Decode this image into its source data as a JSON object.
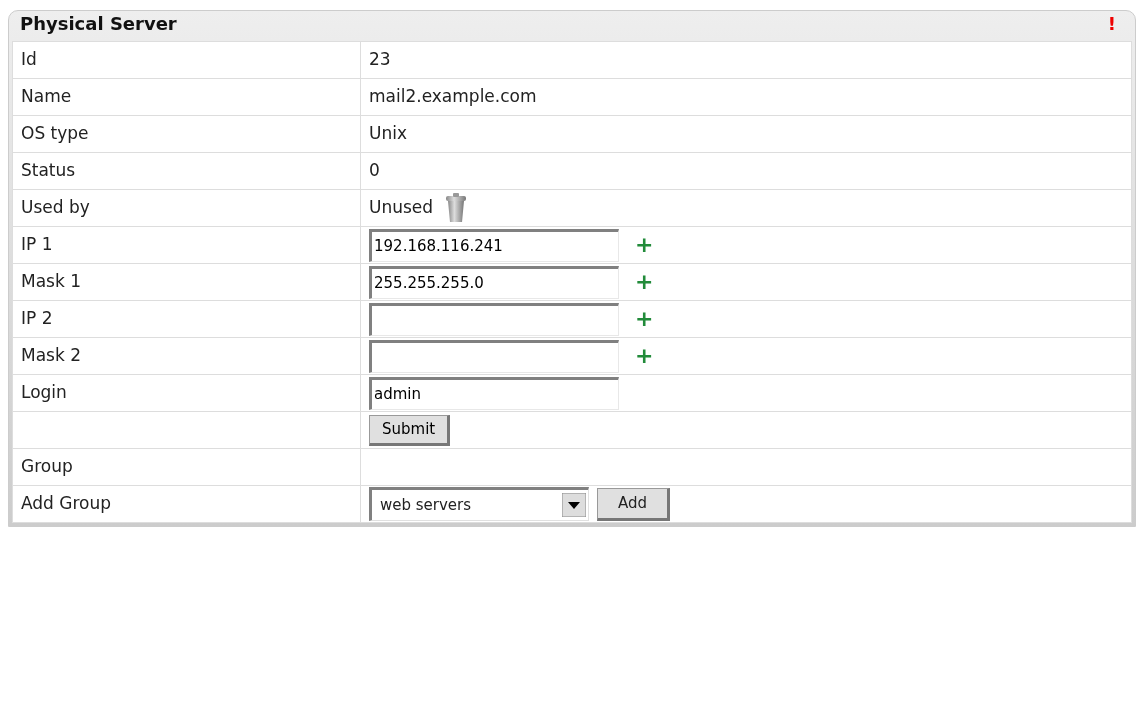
{
  "panel": {
    "title": "Physical Server",
    "alert": "!"
  },
  "rows": [
    {
      "kind": "text",
      "label": "Id",
      "value": "23"
    },
    {
      "kind": "text",
      "label": "Name",
      "value": "mail2.example.com"
    },
    {
      "kind": "text",
      "label": "OS type",
      "value": "Unix"
    },
    {
      "kind": "text",
      "label": "Status",
      "value": "0"
    },
    {
      "kind": "trash",
      "label": "Used by",
      "value": "Unused"
    },
    {
      "kind": "input_plus",
      "label": "IP 1",
      "value": "192.168.116.241",
      "plus": "+"
    },
    {
      "kind": "input_plus",
      "label": "Mask 1",
      "value": "255.255.255.0",
      "plus": "+"
    },
    {
      "kind": "input_plus",
      "label": "IP 2",
      "plus": "+"
    },
    {
      "kind": "input_plus",
      "label": "Mask 2",
      "plus": "+"
    },
    {
      "kind": "input",
      "label": "Login",
      "value": "admin"
    },
    {
      "kind": "button",
      "button": "Submit"
    },
    {
      "kind": "text",
      "label": "Group"
    },
    {
      "kind": "select_add",
      "label": "Add Group",
      "value": "web servers",
      "button": "Add"
    }
  ]
}
